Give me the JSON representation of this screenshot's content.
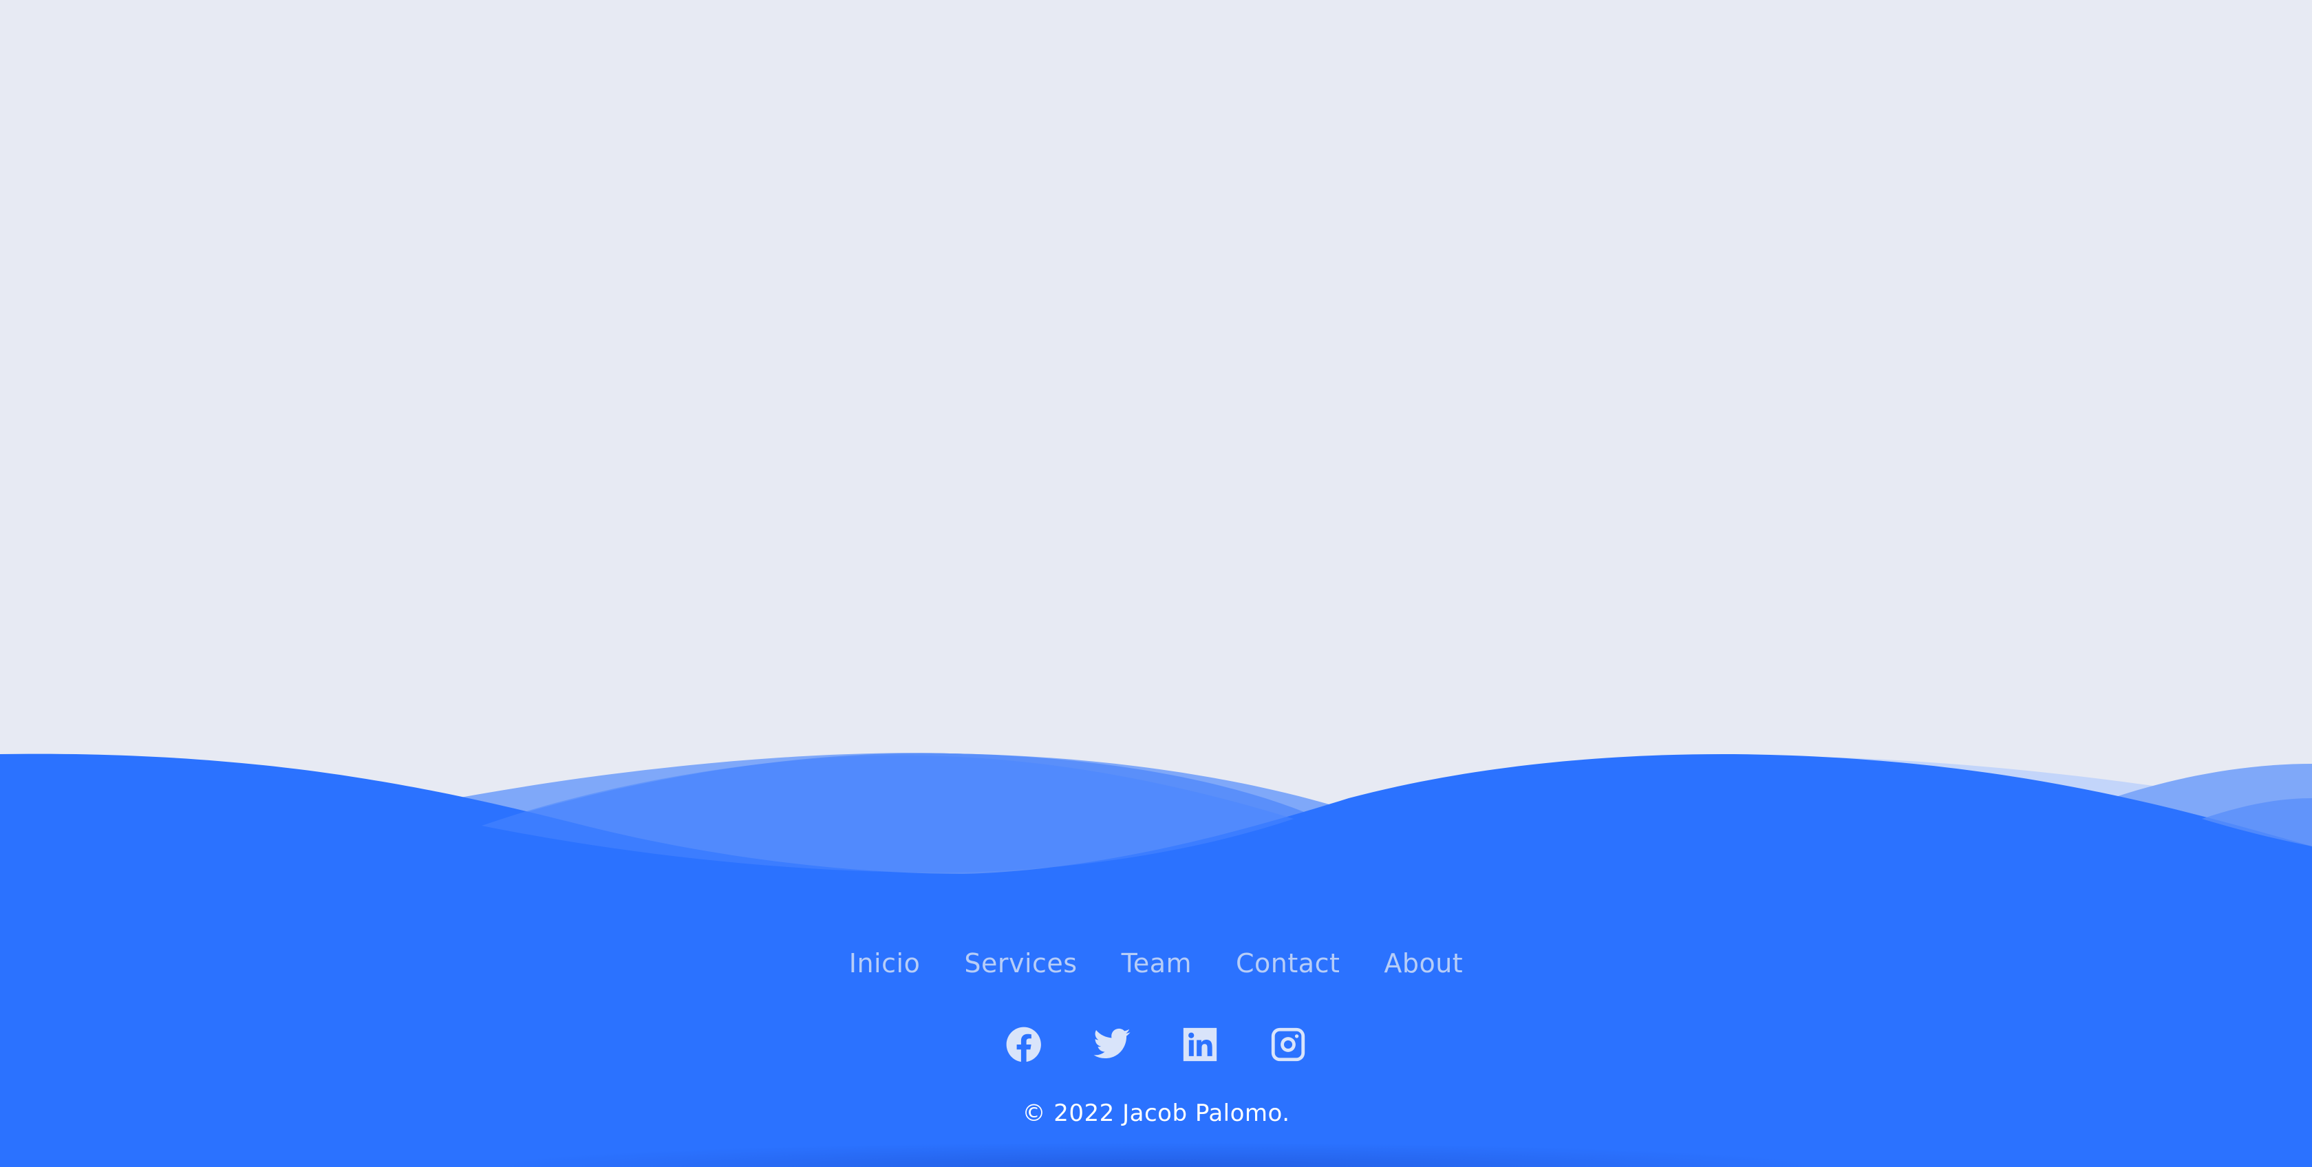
{
  "footer": {
    "nav": [
      {
        "label": "Inicio"
      },
      {
        "label": "Services"
      },
      {
        "label": "Team"
      },
      {
        "label": "Contact"
      },
      {
        "label": "About"
      }
    ],
    "social": [
      {
        "icon": "facebook-icon"
      },
      {
        "icon": "twitter-icon"
      },
      {
        "icon": "linkedin-icon"
      },
      {
        "icon": "instagram-icon"
      }
    ],
    "copyright": "© 2022 Jacob Palomo."
  },
  "colors": {
    "background": "#e7eaf3",
    "footer_blue": "#2b72ff",
    "nav_text": "#b7cdf7",
    "icon": "#d9e4fa",
    "copyright_text": "#ffffff"
  }
}
